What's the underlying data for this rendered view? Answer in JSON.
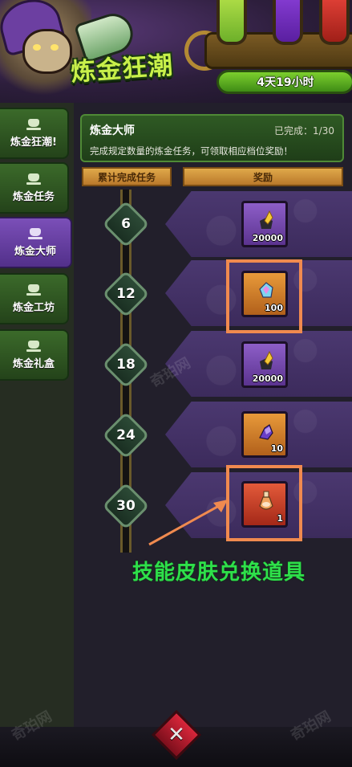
{
  "banner": {
    "title": "炼金狂潮",
    "timer": "4天19小时"
  },
  "sidebar": {
    "items": [
      {
        "label": "炼金狂潮!",
        "active": false
      },
      {
        "label": "炼金任务",
        "active": false
      },
      {
        "label": "炼金大师",
        "active": true
      },
      {
        "label": "炼金工坊",
        "active": false
      },
      {
        "label": "炼金礼盒",
        "active": false
      }
    ]
  },
  "info_card": {
    "title": "炼金大师",
    "progress": "已完成：1/30",
    "description": "完成规定数量的炼金任务，可领取相应档位奖励！"
  },
  "columns": {
    "tasks": "累计完成任务",
    "reward": "奖励"
  },
  "milestones": [
    {
      "count": "6",
      "reward_qty": "20000",
      "rarity": "purple",
      "icon": "gold-ore-icon"
    },
    {
      "count": "12",
      "reward_qty": "100",
      "rarity": "orange",
      "icon": "crystal-icon"
    },
    {
      "count": "18",
      "reward_qty": "20000",
      "rarity": "purple",
      "icon": "gold-ore-icon"
    },
    {
      "count": "24",
      "reward_qty": "10",
      "rarity": "orange",
      "icon": "purple-crystal-icon"
    },
    {
      "count": "30",
      "reward_qty": "1",
      "rarity": "red",
      "icon": "potion-icon"
    }
  ],
  "annotation": {
    "text": "技能皮肤兑换道具"
  },
  "watermarks": [
    "奇珀网",
    "奇珀网",
    "奇珀网"
  ],
  "colors": {
    "accent_green": "#2ee04a",
    "highlight_orange": "#f08a4f",
    "active_tab_purple": "#7b4fb8"
  }
}
